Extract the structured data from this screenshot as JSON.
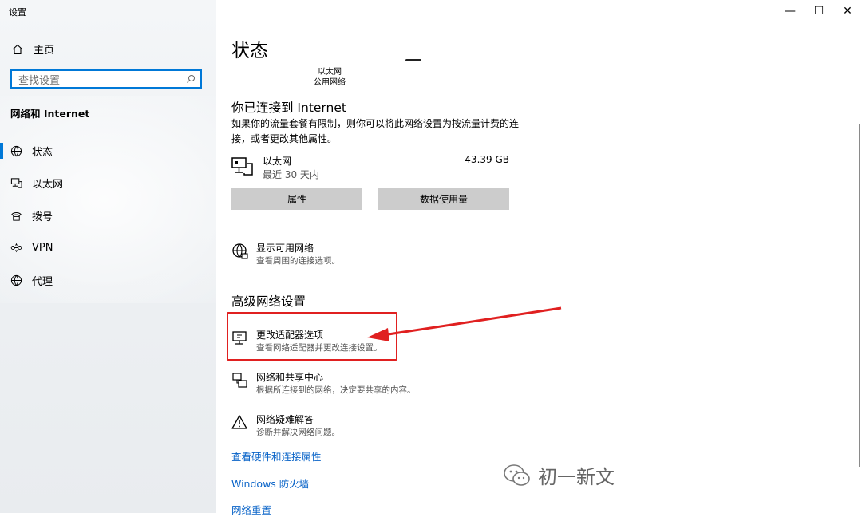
{
  "window": {
    "title": "设置",
    "controls": {
      "minimize": "—",
      "maximize": "☐",
      "close": "✕"
    }
  },
  "sidebar": {
    "home_label": "主页",
    "search_placeholder": "查找设置",
    "section_title": "网络和 Internet",
    "items": [
      {
        "label": "状态",
        "icon": "status-icon",
        "active": true
      },
      {
        "label": "以太网",
        "icon": "ethernet-icon"
      },
      {
        "label": "拨号",
        "icon": "dialup-icon"
      },
      {
        "label": "VPN",
        "icon": "vpn-icon"
      },
      {
        "label": "代理",
        "icon": "globe-icon"
      }
    ]
  },
  "main": {
    "title": "状态",
    "network_name": "以太网",
    "network_type": "公用网络",
    "connected_heading": "你已连接到 Internet",
    "connected_desc": "如果你的流量套餐有限制，则你可以将此网络设置为按流量计费的连接，或者更改其他属性。",
    "ethernet": {
      "name": "以太网",
      "period": "最近 30 天内",
      "usage": "43.39 GB"
    },
    "buttons": {
      "properties": "属性",
      "data_usage": "数据使用量"
    },
    "show_networks": {
      "title": "显示可用网络",
      "desc": "查看周围的连接选项。"
    },
    "advanced_heading": "高级网络设置",
    "advanced_items": [
      {
        "title": "更改适配器选项",
        "desc": "查看网络适配器并更改连接设置。"
      },
      {
        "title": "网络和共享中心",
        "desc": "根据所连接到的网络，决定要共享的内容。"
      },
      {
        "title": "网络疑难解答",
        "desc": "诊断并解决网络问题。"
      }
    ],
    "links": [
      "查看硬件和连接属性",
      "Windows 防火墙",
      "网络重置"
    ]
  },
  "watermark": {
    "text": "初一新文"
  },
  "colors": {
    "accent": "#0078d7",
    "highlight": "#e02020",
    "link": "#0a64c8"
  }
}
